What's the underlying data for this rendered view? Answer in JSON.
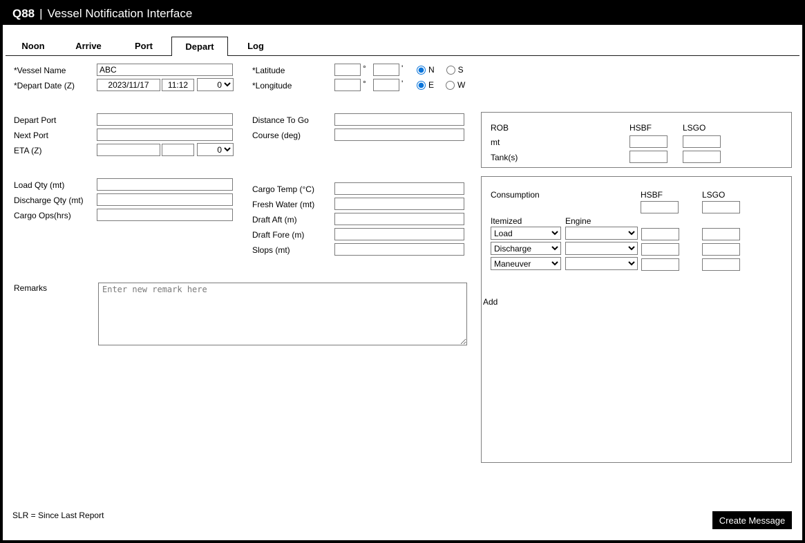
{
  "header": {
    "brand": "Q88",
    "separator": "|",
    "title": "Vessel Notification Interface"
  },
  "tabs": [
    {
      "label": "Noon"
    },
    {
      "label": "Arrive"
    },
    {
      "label": "Port"
    },
    {
      "label": "Depart",
      "active": true
    },
    {
      "label": "Log"
    }
  ],
  "form": {
    "vessel_name": {
      "label": "*Vessel Name",
      "value": "ABC"
    },
    "depart_date": {
      "label": "*Depart Date (Z)",
      "date": "2023/11/17",
      "time": "11:12",
      "offset": "0"
    },
    "latitude": {
      "label": "*Latitude",
      "degrees": "",
      "minutes": "",
      "degree_symbol": "°",
      "minute_symbol": "'",
      "hemisphere_options": [
        "N",
        "S"
      ],
      "selected": "N"
    },
    "longitude": {
      "label": "*Longitude",
      "degrees": "",
      "minutes": "",
      "degree_symbol": "°",
      "minute_symbol": "'",
      "hemisphere_options": [
        "E",
        "W"
      ],
      "selected": "E"
    },
    "depart_port": {
      "label": "Depart Port",
      "value": ""
    },
    "next_port": {
      "label": "Next Port",
      "value": ""
    },
    "eta": {
      "label": "ETA (Z)",
      "date": "",
      "time": "",
      "offset": "0"
    },
    "distance_to_go": {
      "label": "Distance To Go",
      "value": ""
    },
    "course": {
      "label": "Course (deg)",
      "value": ""
    },
    "load_qty": {
      "label": "Load Qty (mt)",
      "value": ""
    },
    "discharge_qty": {
      "label": "Discharge Qty (mt)",
      "value": ""
    },
    "cargo_ops": {
      "label": "Cargo Ops(hrs)",
      "value": ""
    },
    "cargo_temp": {
      "label": "Cargo Temp (°C)",
      "value": ""
    },
    "fresh_water": {
      "label": "Fresh Water (mt)",
      "value": ""
    },
    "draft_aft": {
      "label": "Draft Aft (m)",
      "value": ""
    },
    "draft_fore": {
      "label": "Draft Fore (m)",
      "value": ""
    },
    "slops": {
      "label": "Slops (mt)",
      "value": ""
    },
    "remarks": {
      "label": "Remarks",
      "placeholder": "Enter new remark here",
      "value": ""
    }
  },
  "rob": {
    "title": "ROB",
    "columns": [
      "HSBF",
      "LSGO"
    ],
    "rows": [
      {
        "label": "mt",
        "hsbf": "",
        "lsgo": ""
      },
      {
        "label": "Tank(s)",
        "hsbf": "",
        "lsgo": ""
      }
    ]
  },
  "consumption": {
    "title": "Consumption",
    "columns": [
      "HSBF",
      "LSGO"
    ],
    "totals": {
      "hsbf": "",
      "lsgo": ""
    },
    "itemized_header": "Itemized",
    "engine_header": "Engine",
    "rows": [
      {
        "itemized": "Load",
        "engine": "",
        "hsbf": "",
        "lsgo": ""
      },
      {
        "itemized": "Discharge",
        "engine": "",
        "hsbf": "",
        "lsgo": ""
      },
      {
        "itemized": "Maneuver",
        "engine": "",
        "hsbf": "",
        "lsgo": ""
      }
    ],
    "add_label": "Add"
  },
  "footer": {
    "note": "SLR = Since Last Report",
    "create_button": "Create Message"
  }
}
